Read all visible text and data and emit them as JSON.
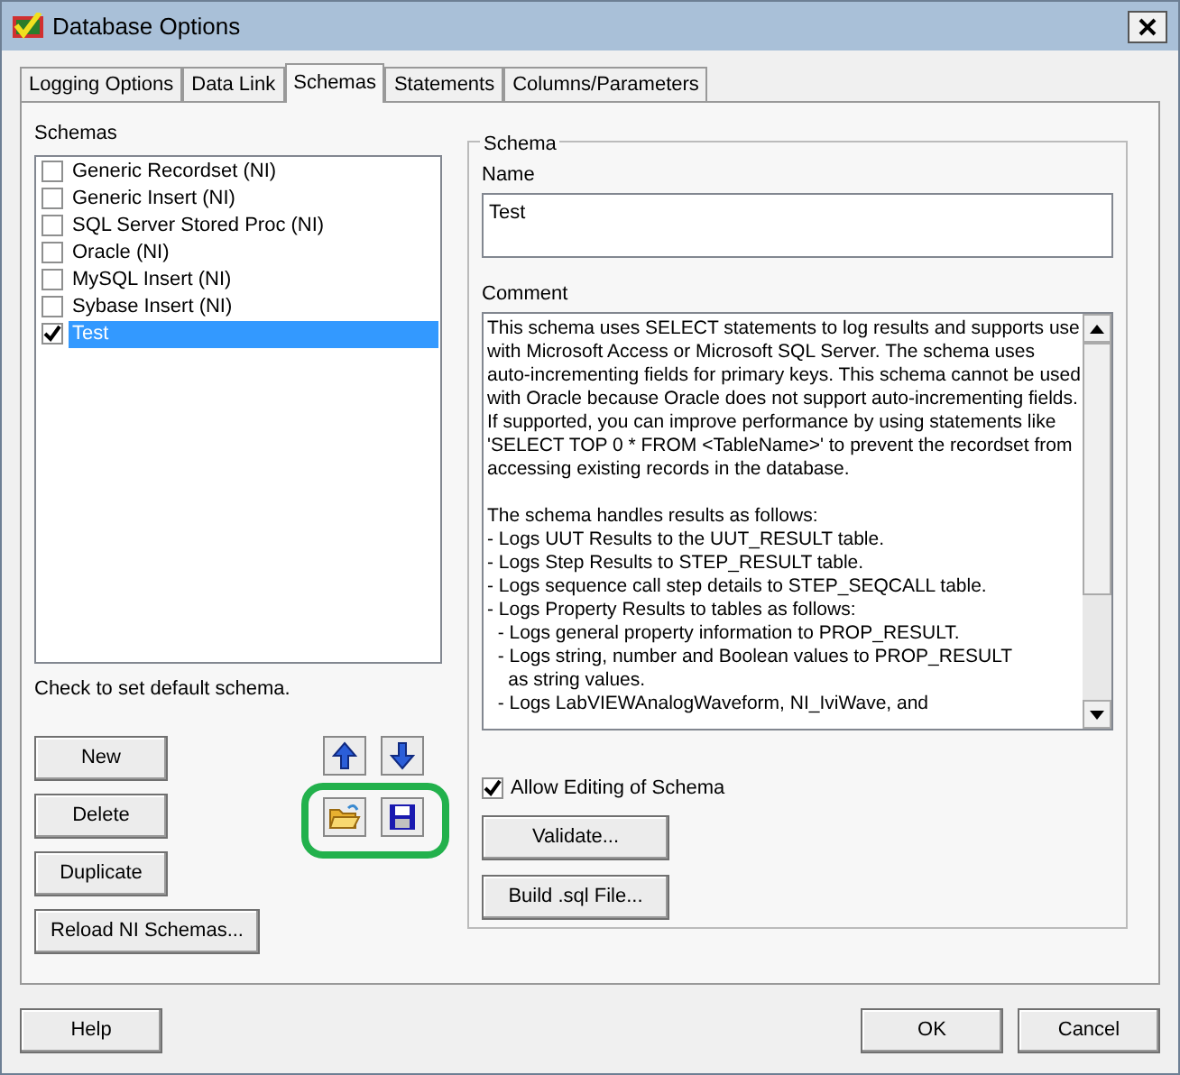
{
  "window": {
    "title": "Database Options"
  },
  "tabs": [
    {
      "label": "Logging Options",
      "selected": false
    },
    {
      "label": "Data Link",
      "selected": false
    },
    {
      "label": "Schemas",
      "selected": true
    },
    {
      "label": "Statements",
      "selected": false
    },
    {
      "label": "Columns/Parameters",
      "selected": false
    }
  ],
  "schemas": {
    "label": "Schemas",
    "items": [
      {
        "label": "Generic Recordset (NI)",
        "checked": false,
        "selected": false
      },
      {
        "label": "Generic Insert (NI)",
        "checked": false,
        "selected": false
      },
      {
        "label": "SQL Server Stored Proc (NI)",
        "checked": false,
        "selected": false
      },
      {
        "label": "Oracle (NI)",
        "checked": false,
        "selected": false
      },
      {
        "label": "MySQL Insert (NI)",
        "checked": false,
        "selected": false
      },
      {
        "label": "Sybase Insert (NI)",
        "checked": false,
        "selected": false
      },
      {
        "label": "Test",
        "checked": true,
        "selected": true
      }
    ],
    "hint": "Check to set default schema.",
    "buttons": [
      "New",
      "Delete",
      "Duplicate",
      "Reload NI Schemas..."
    ]
  },
  "schema": {
    "title": "Schema",
    "name_label": "Name",
    "name_value": "Test",
    "comment_label": "Comment",
    "comment_paragraphs": [
      [
        "This schema uses SELECT statements to log results and supports use",
        "with Microsoft Access or Microsoft SQL Server. The schema uses",
        "auto-incrementing fields for primary keys. This schema cannot be used",
        "with Oracle because Oracle does not support auto-incrementing fields.",
        "If supported, you can improve performance by using statements like",
        "'SELECT TOP 0 * FROM <TableName>' to prevent the recordset from",
        "accessing existing records in the database."
      ],
      [
        "The schema handles results as follows:",
        "- Logs UUT Results to the UUT_RESULT table.",
        "- Logs Step Results to STEP_RESULT table.",
        "- Logs sequence call step details to STEP_SEQCALL table.",
        "- Logs Property Results to tables as follows:",
        "  - Logs general property information to PROP_RESULT.",
        "  - Logs string, number and Boolean values to PROP_RESULT",
        "    as string values.",
        "  - Logs LabVIEWAnalogWaveform, NI_IviWave, and"
      ]
    ],
    "allow_editing": {
      "label": "Allow Editing of Schema",
      "checked": true
    },
    "buttons": [
      "Validate...",
      "Build .sql File..."
    ]
  },
  "footer": {
    "help": "Help",
    "ok": "OK",
    "cancel": "Cancel"
  }
}
